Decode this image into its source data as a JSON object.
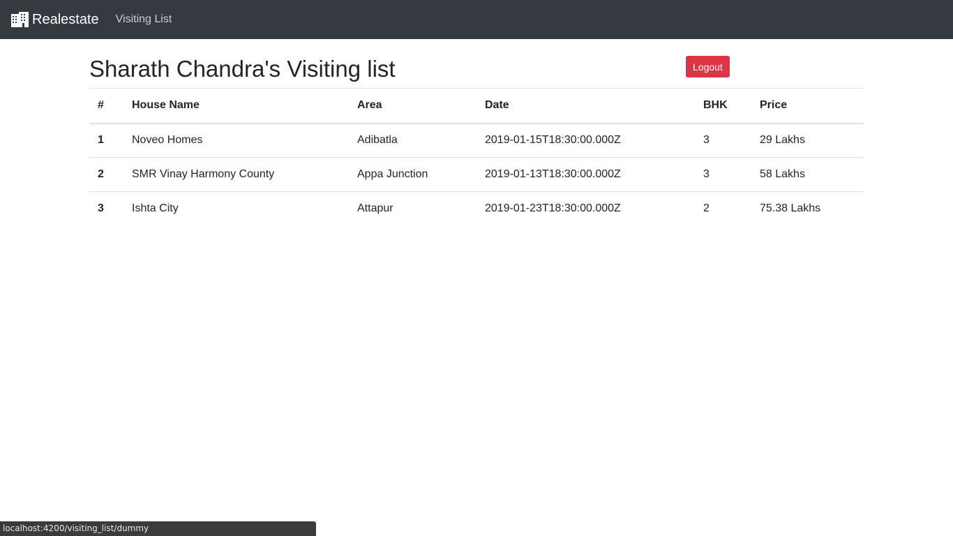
{
  "navbar": {
    "brand": "Realestate",
    "brand_icon": "building-icon",
    "links": [
      "Visiting List"
    ]
  },
  "page": {
    "title": "Sharath Chandra's Visiting list",
    "logout_label": "Logout"
  },
  "table": {
    "headers": [
      "#",
      "House Name",
      "Area",
      "Date",
      "BHK",
      "Price"
    ],
    "rows": [
      [
        "1",
        "Noveo Homes",
        "Adibatla",
        "2019-01-15T18:30:00.000Z",
        "3",
        "29 Lakhs"
      ],
      [
        "2",
        "SMR Vinay Harmony County",
        "Appa Junction",
        "2019-01-13T18:30:00.000Z",
        "3",
        "58 Lakhs"
      ],
      [
        "3",
        "Ishta City",
        "Attapur",
        "2019-01-23T18:30:00.000Z",
        "2",
        "75.38 Lakhs"
      ]
    ]
  },
  "status_bar": {
    "url": "localhost:4200/visiting_list/dummy"
  },
  "colors": {
    "navbar_bg": "#343a40",
    "danger": "#dc3545"
  }
}
